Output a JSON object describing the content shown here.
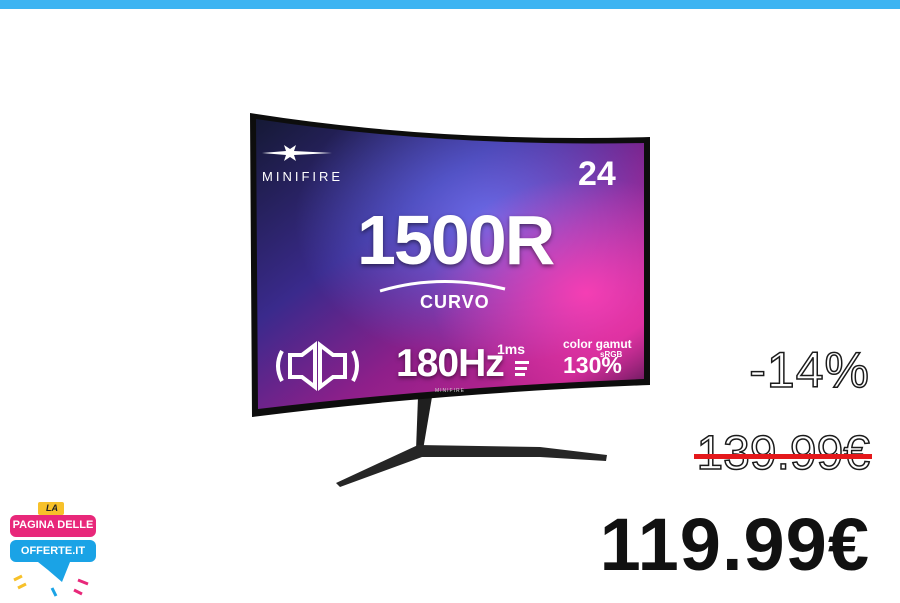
{
  "monitor": {
    "brand_logo": "MINIFIRE",
    "size": "24",
    "curvature": "1500R",
    "curve_label": "CURVO",
    "refresh_rate": "180Hz",
    "response_time": "1ms",
    "color_gamut_label": "color gamut",
    "color_gamut_value": "130%",
    "color_space": "sRGB",
    "bezel_brand": "MINIFIRE",
    "speaker_icon": "speaker-icon"
  },
  "pricing": {
    "discount": "-14%",
    "old_price": "139.99€",
    "new_price": "119.99€"
  },
  "brand": {
    "line_top": "LA",
    "line_1": "PAGINA DELLE",
    "line_2": "OFFERTE.IT"
  },
  "colors": {
    "accent_top_bar": "#3db4f2",
    "strike_red": "#e4181b",
    "brand_pink": "#e8287a",
    "brand_blue": "#1aa3e6",
    "brand_yellow": "#f7c12a"
  }
}
